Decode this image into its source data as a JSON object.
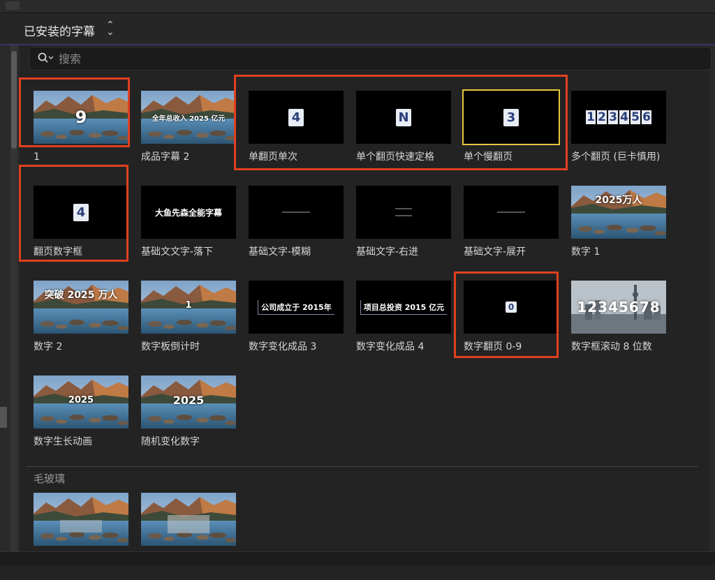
{
  "header": {
    "title": "已安装的字幕"
  },
  "search": {
    "placeholder": "搜索"
  },
  "grid": {
    "items": [
      {
        "label": "1",
        "thumb": "landscape",
        "overlay": "9",
        "overlay_style": "big-num"
      },
      {
        "label": "成品字幕 2",
        "thumb": "landscape",
        "overlay": "全年总收入 2025 亿元",
        "overlay_style": "line"
      },
      {
        "label": "单翻页单次",
        "thumb": "black",
        "overlay": "4",
        "overlay_style": "flip"
      },
      {
        "label": "单个翻页快速定格",
        "thumb": "black",
        "overlay": "N",
        "overlay_style": "flip"
      },
      {
        "label": "单个慢翻页",
        "thumb": "black",
        "overlay": "3",
        "overlay_style": "flip",
        "selected": true
      },
      {
        "label": "多个翻页 (巨卡慎用)",
        "thumb": "black",
        "overlay": "123456",
        "overlay_style": "digits"
      },
      {
        "label": "翻页数字框",
        "thumb": "black",
        "overlay": "4",
        "overlay_style": "flip"
      },
      {
        "label": "基础文文字-落下",
        "thumb": "black",
        "overlay": "大鱼先森全能字幕",
        "overlay_style": "title"
      },
      {
        "label": "基础文字-模糊",
        "thumb": "black",
        "overlay": "",
        "overlay_style": "tiny"
      },
      {
        "label": "基础文字-右进",
        "thumb": "black",
        "overlay": "",
        "overlay_style": "tiny2"
      },
      {
        "label": "基础文字-展开",
        "thumb": "black",
        "overlay": "",
        "overlay_style": "tiny"
      },
      {
        "label": "数字 1",
        "thumb": "landscape",
        "overlay": "2025万人",
        "overlay_style": "mid"
      },
      {
        "label": "数字 2",
        "thumb": "landscape",
        "overlay": "突破 2025 万人",
        "overlay_style": "mid"
      },
      {
        "label": "数字板倒计时",
        "thumb": "landscape",
        "overlay": "1",
        "overlay_style": "small-num"
      },
      {
        "label": "数字变化成品 3",
        "thumb": "black",
        "overlay": "公司成立于 2015年",
        "overlay_style": "line-black"
      },
      {
        "label": "数字变化成品 4",
        "thumb": "black",
        "overlay": "项目总投资 2015 亿元",
        "overlay_style": "line-black"
      },
      {
        "label": "数字翻页 0-9",
        "thumb": "black",
        "overlay": "0",
        "overlay_style": "flip-small"
      },
      {
        "label": "数字框滚动 8 位数",
        "thumb": "city",
        "overlay": "12345678",
        "overlay_style": "city-digits"
      },
      {
        "label": "数字生长动画",
        "thumb": "landscape",
        "overlay": "2025",
        "overlay_style": "small-num"
      },
      {
        "label": "随机变化数字",
        "thumb": "landscape",
        "overlay": "2025",
        "overlay_style": "mid-num"
      }
    ]
  },
  "section2": {
    "title": "毛玻璃",
    "items": [
      {
        "thumb": "landscape",
        "overlay_style": "glass"
      },
      {
        "thumb": "landscape",
        "overlay_style": "glass2"
      }
    ]
  },
  "colors": {
    "highlight_red": "#e0401f",
    "selection_yellow": "#e6c73a",
    "background": "#232323"
  }
}
